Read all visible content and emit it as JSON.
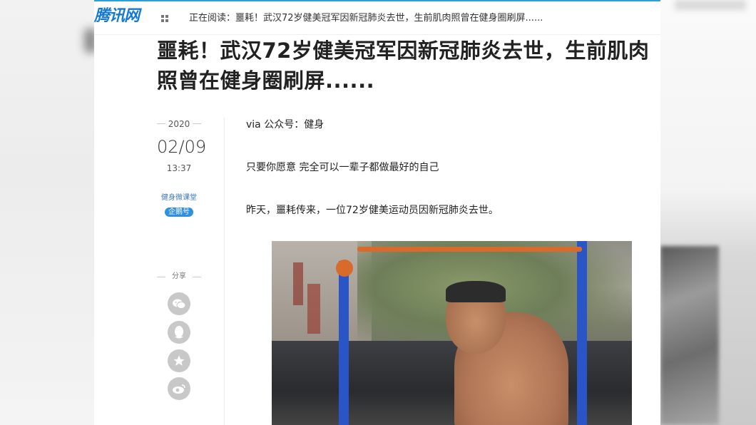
{
  "site": {
    "logo": "腾讯网"
  },
  "topbar": {
    "reading_label": "正在阅读：噩耗！武汉72岁健美冠军因新冠肺炎去世，生前肌肉照曾在健身圈刷屏......"
  },
  "article": {
    "headline": "噩耗！武汉72岁健美冠军因新冠肺炎去世，生前肌肉照曾在健身圈刷屏......",
    "year": "2020",
    "date": "02/09",
    "time": "13:37",
    "author": "健身微课堂",
    "badge": "企鹅号",
    "paragraphs": [
      "via 公众号：健身",
      "只要你愿意 完全可以一辈子都做最好的自己",
      "昨天，噩耗传来，一位72岁健美运动员因新冠肺炎去世。"
    ]
  },
  "share": {
    "label": "分享",
    "buttons": [
      "wechat-icon",
      "qq-icon",
      "favorite-star-icon",
      "weibo-icon"
    ]
  },
  "colors": {
    "accent": "#1479d7",
    "badge": "#2f8fe0",
    "share_button": "#c8c8c8"
  }
}
